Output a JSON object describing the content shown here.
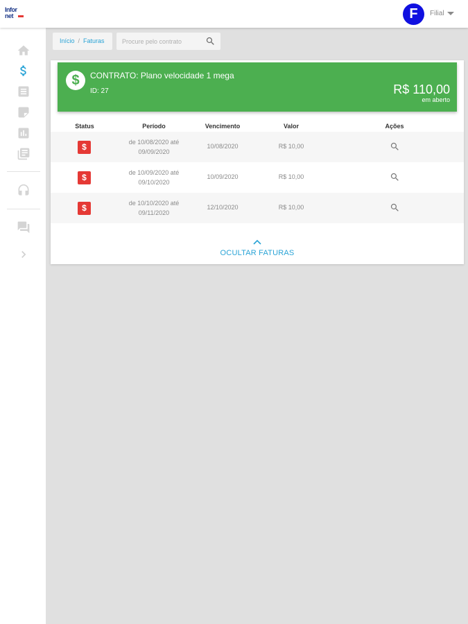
{
  "header": {
    "logo_line1": "Infor",
    "logo_line2": "net",
    "avatar_letter": "F",
    "user_name": "Filial"
  },
  "sidebar": {
    "items": [
      {
        "icon": "home-icon"
      },
      {
        "icon": "dollar-icon",
        "active": true
      },
      {
        "icon": "document-icon"
      },
      {
        "icon": "tag-icon"
      },
      {
        "icon": "bar-chart-icon"
      },
      {
        "icon": "library-icon"
      },
      {
        "icon": "headset-icon"
      },
      {
        "icon": "chat-icon"
      },
      {
        "icon": "chevron-right-icon"
      }
    ]
  },
  "breadcrumb": {
    "home": "Início",
    "separator": "/",
    "current": "Faturas"
  },
  "search": {
    "placeholder": "Procure pelo contrato"
  },
  "contract": {
    "title": "CONTRATO: Plano velocidade 1 mega",
    "id_label": "ID: 27",
    "amount": "R$ 110,00",
    "status": "em aberto"
  },
  "table": {
    "headers": {
      "status": "Status",
      "period": "Período",
      "due": "Vencimento",
      "value": "Valor",
      "actions": "Ações"
    },
    "rows": [
      {
        "badge": "$",
        "period_line1": "de 10/08/2020 até",
        "period_line2": "09/09/2020",
        "due": "10/08/2020",
        "value": "R$ 10,00"
      },
      {
        "badge": "$",
        "period_line1": "de 10/09/2020 até",
        "period_line2": "09/10/2020",
        "due": "10/09/2020",
        "value": "R$ 10,00"
      },
      {
        "badge": "$",
        "period_line1": "de 10/10/2020 até",
        "period_line2": "09/11/2020",
        "due": "12/10/2020",
        "value": "R$ 10,00"
      }
    ]
  },
  "toggle": {
    "label": "OCULTAR FATURAS"
  },
  "colors": {
    "brand_green": "#4caf50",
    "accent_blue": "#29a3d6",
    "badge_red": "#e53935",
    "avatar_blue": "#1010e0"
  }
}
